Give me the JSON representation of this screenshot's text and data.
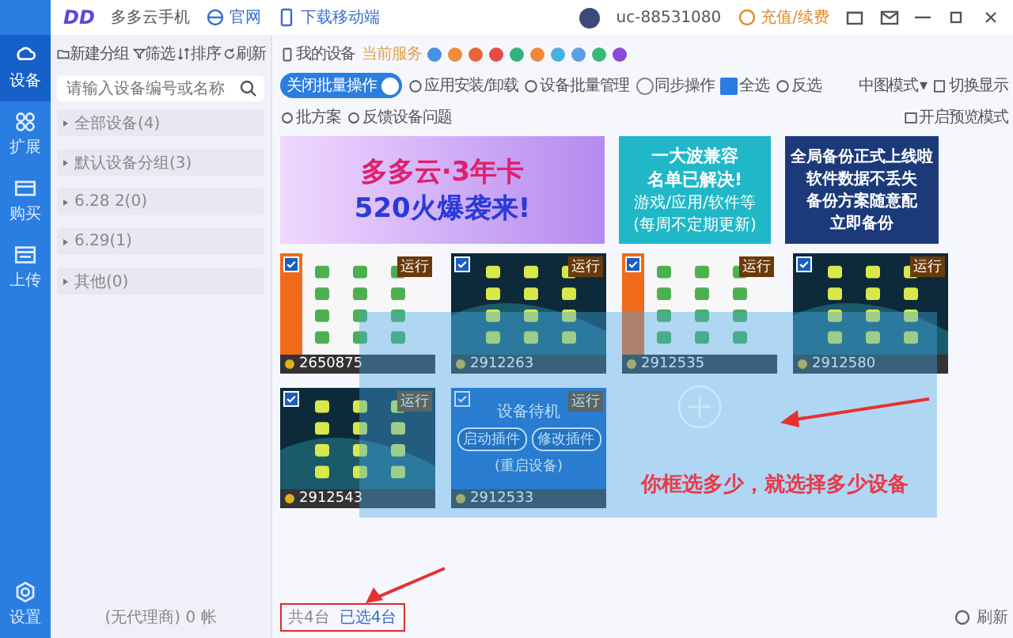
{
  "app": {
    "logo": "DD",
    "name": "多多云手机",
    "links": [
      "官网",
      "下载移动端"
    ],
    "user": "uc-88531080",
    "recharge": "充值/续费"
  },
  "rail": [
    {
      "label": "设备",
      "selected": true
    },
    {
      "label": "扩展",
      "selected": false
    },
    {
      "label": "购买",
      "selected": false
    },
    {
      "label": "上传",
      "selected": false
    }
  ],
  "rail_bottom": "设置",
  "groups_toolbar": [
    "新建分组",
    "筛选",
    "排序",
    "刷新"
  ],
  "search": {
    "placeholder": "请输入设备编号或名称"
  },
  "groups": [
    "全部设备(4)",
    "默认设备分组(3)",
    "6.28 2(0)",
    "6.29(1)",
    "其他(0)"
  ],
  "agent": "(无代理商) 0 帐",
  "header": {
    "my_devices": "我的设备",
    "service": "当前服务",
    "services": [
      {
        "color": "#4a90e2"
      },
      {
        "color": "#f08a3c"
      },
      {
        "color": "#e8643c"
      },
      {
        "color": "#e84a4a"
      },
      {
        "color": "#2fb37a"
      },
      {
        "color": "#f0883c"
      },
      {
        "color": "#4ab0e0"
      },
      {
        "color": "#5a9ee8"
      },
      {
        "color": "#3ab878"
      },
      {
        "color": "#8a4ad8"
      }
    ]
  },
  "toolbar": {
    "batch": {
      "label": "关闭批量操作",
      "on": true
    },
    "actions": [
      {
        "label": "应用安装/卸载",
        "kind": "action"
      },
      {
        "label": "设备批量管理",
        "kind": "action"
      },
      {
        "label": "同步操作",
        "kind": "radio",
        "checked": false
      },
      {
        "label": "全选",
        "kind": "checkbox",
        "checked": true
      },
      {
        "label": "反选",
        "kind": "action"
      }
    ],
    "view_mode": "中图模式",
    "view_mode_caret": "▾",
    "switch_display": "切换显示"
  },
  "subbar": [
    "批方案",
    "反馈设备问题"
  ],
  "preview": "开启预览模式",
  "banners": [
    {
      "lines": [
        "多多云·3年卡",
        "520火爆袭来!"
      ]
    },
    {
      "lines": [
        "一大波兼容",
        "名单已解决!",
        "游戏/应用/软件等",
        "(每周不定期更新)"
      ]
    },
    {
      "lines": [
        "全局备份正式上线啦",
        "软件数据不丢失",
        "备份方案随意配",
        "立即备份"
      ]
    }
  ],
  "devices": [
    {
      "id": "2650875",
      "checked": true,
      "kind": "screen",
      "tag": "运行"
    },
    {
      "id": "2912263",
      "checked": true,
      "kind": "screen",
      "tag": "运行"
    },
    {
      "id": "2912535",
      "checked": true,
      "kind": "screen",
      "tag": "运行"
    },
    {
      "id": "2912580",
      "checked": true,
      "kind": "screen",
      "tag": "运行"
    },
    {
      "id": "2912543",
      "checked": true,
      "kind": "screen",
      "tag": "运行"
    },
    {
      "id": "2912533",
      "checked": true,
      "kind": "idle",
      "tag": "运行",
      "status": "设备待机",
      "buttons": [
        "启动插件",
        "修改插件"
      ],
      "link": "(重启设备)"
    }
  ],
  "note": "你框选多少，就选择多少设备",
  "footer": {
    "total": "共4台",
    "selected": "已选4台",
    "refresh": "刷新"
  }
}
